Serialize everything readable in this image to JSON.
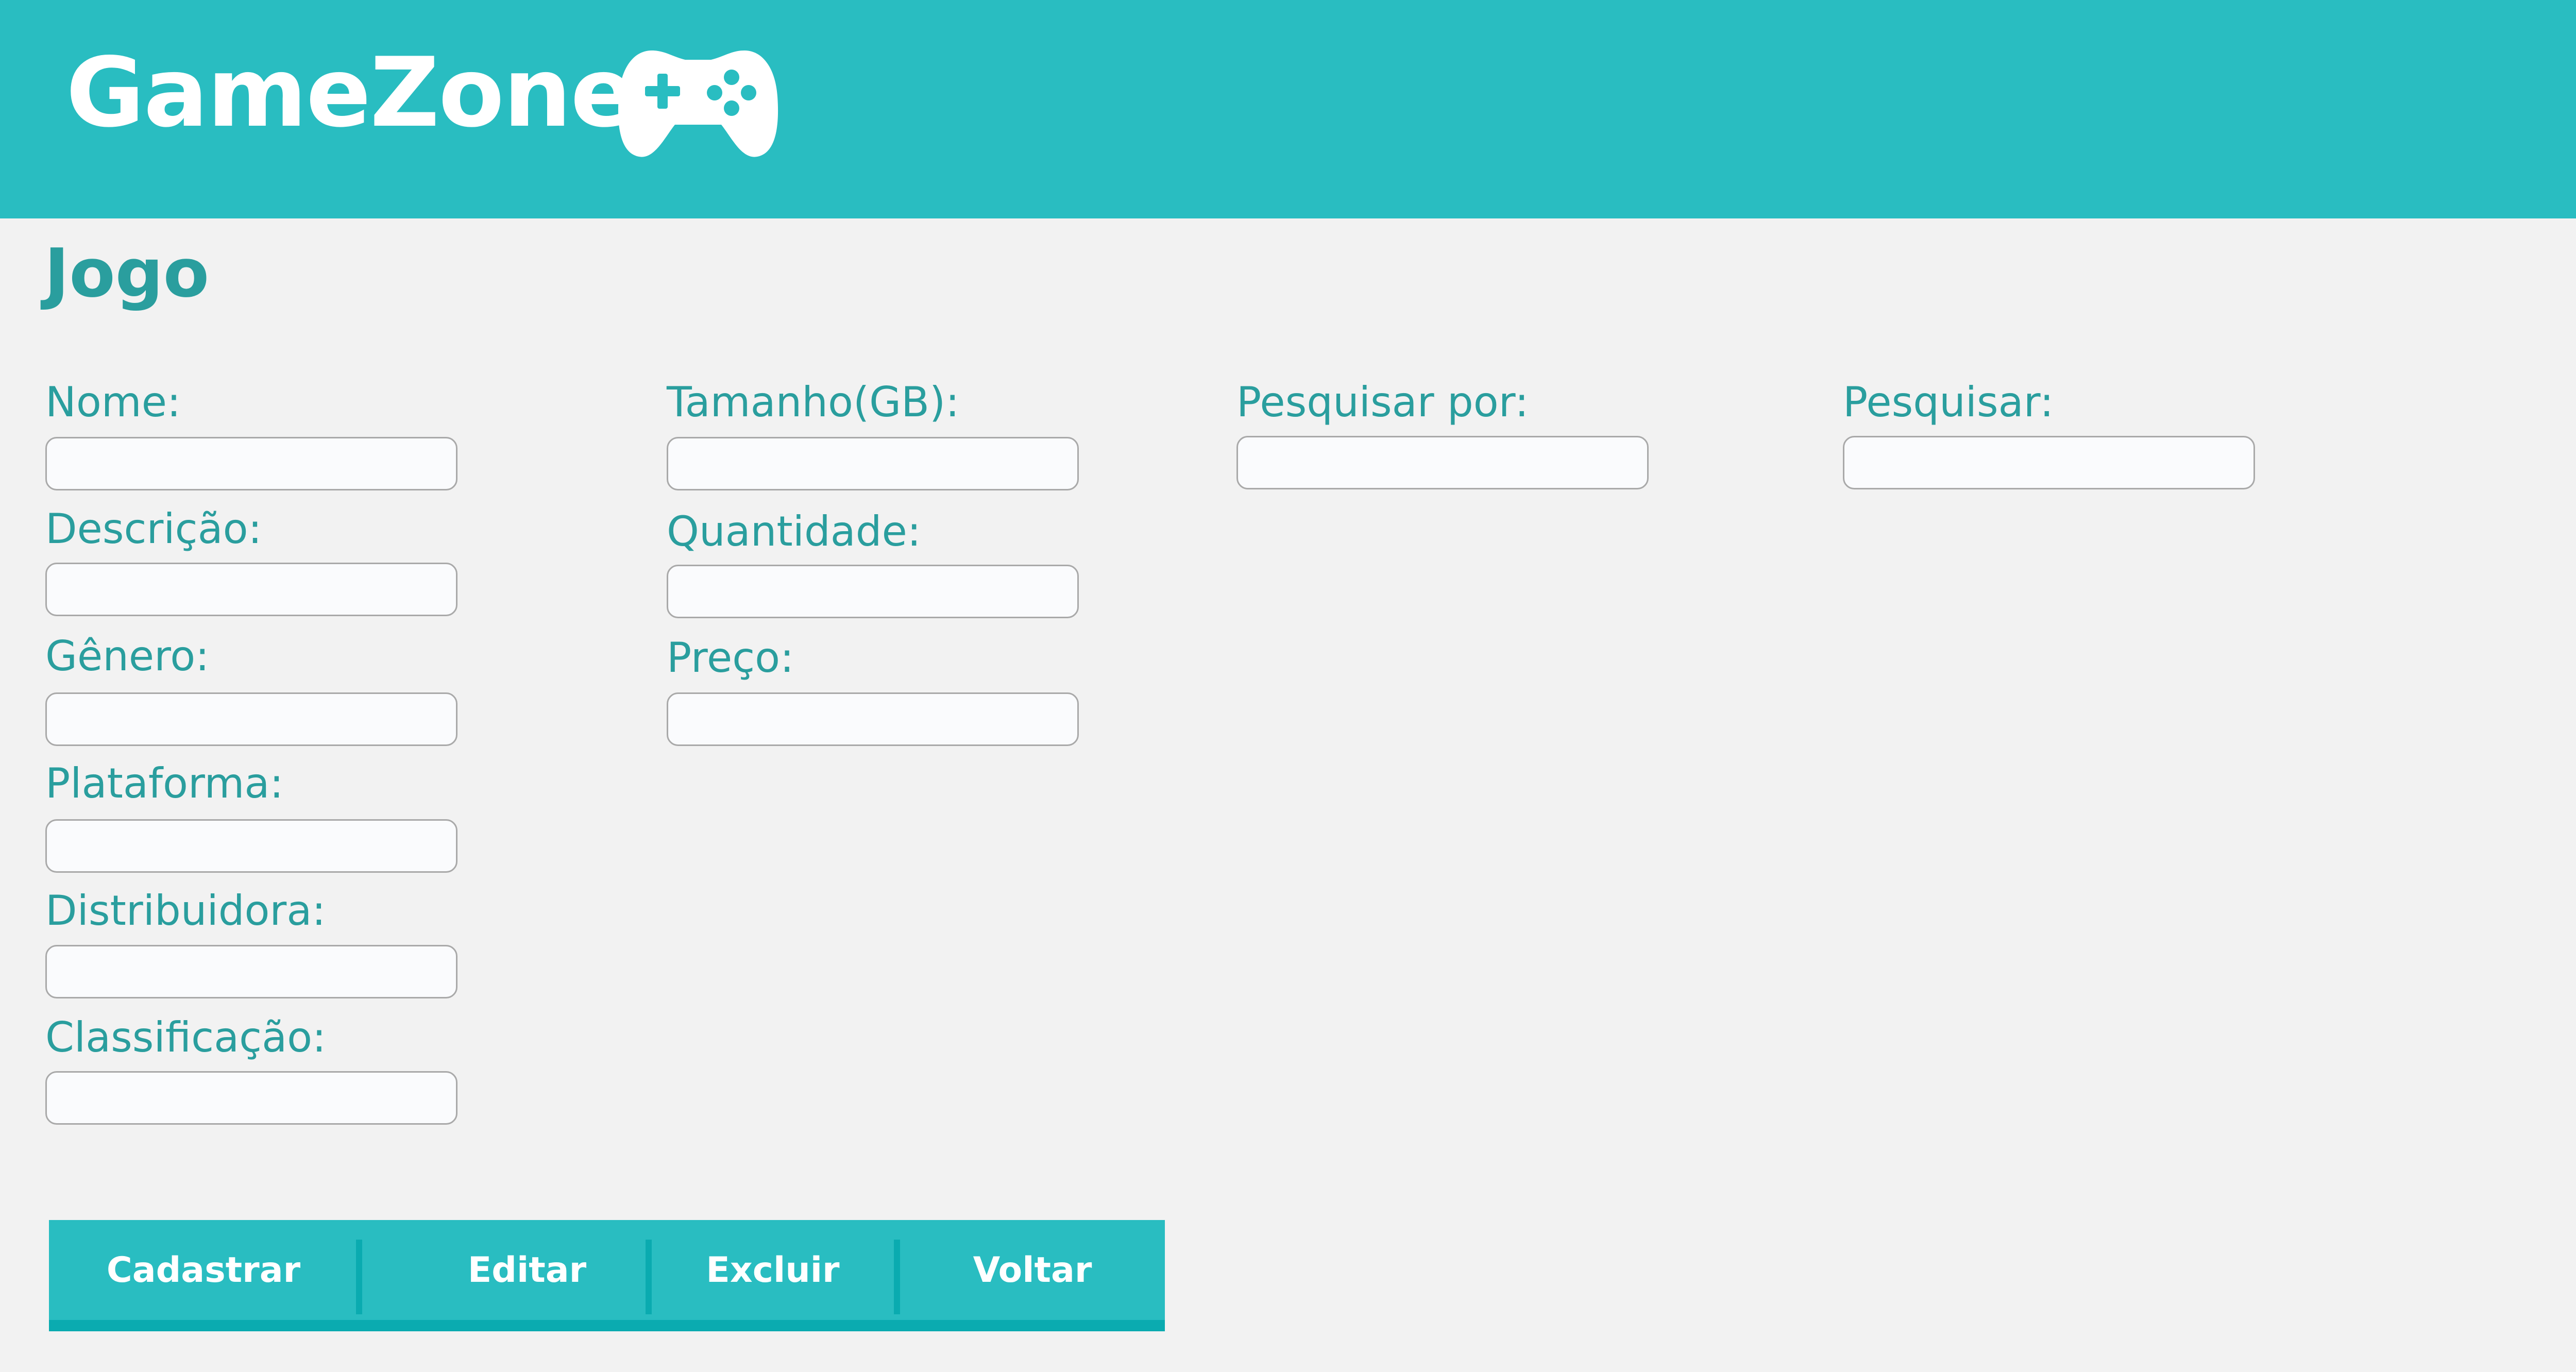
{
  "header": {
    "brand": "GameZone",
    "icon": "gamepad-icon",
    "bg_color": "#29bdc1"
  },
  "page": {
    "title": "Jogo",
    "accent_color": "#2a9e9e"
  },
  "form": {
    "nome": {
      "label": "Nome:",
      "value": ""
    },
    "descricao": {
      "label": "Descrição:",
      "value": ""
    },
    "genero": {
      "label": "Gênero:",
      "value": ""
    },
    "plataforma": {
      "label": "Plataforma:",
      "value": ""
    },
    "distribuidora": {
      "label": "Distribuidora:",
      "value": ""
    },
    "classificacao": {
      "label": "Classificação:",
      "value": ""
    },
    "tamanho": {
      "label": "Tamanho(GB):",
      "value": ""
    },
    "quantidade": {
      "label": "Quantidade:",
      "value": ""
    },
    "preco": {
      "label": "Preço:",
      "value": ""
    }
  },
  "search": {
    "pesquisar_por": {
      "label": "Pesquisar por:",
      "value": ""
    },
    "pesquisar": {
      "label": "Pesquisar:",
      "value": ""
    }
  },
  "actions": {
    "cadastrar": "Cadastrar",
    "editar": "Editar",
    "excluir": "Excluir",
    "voltar": "Voltar"
  }
}
